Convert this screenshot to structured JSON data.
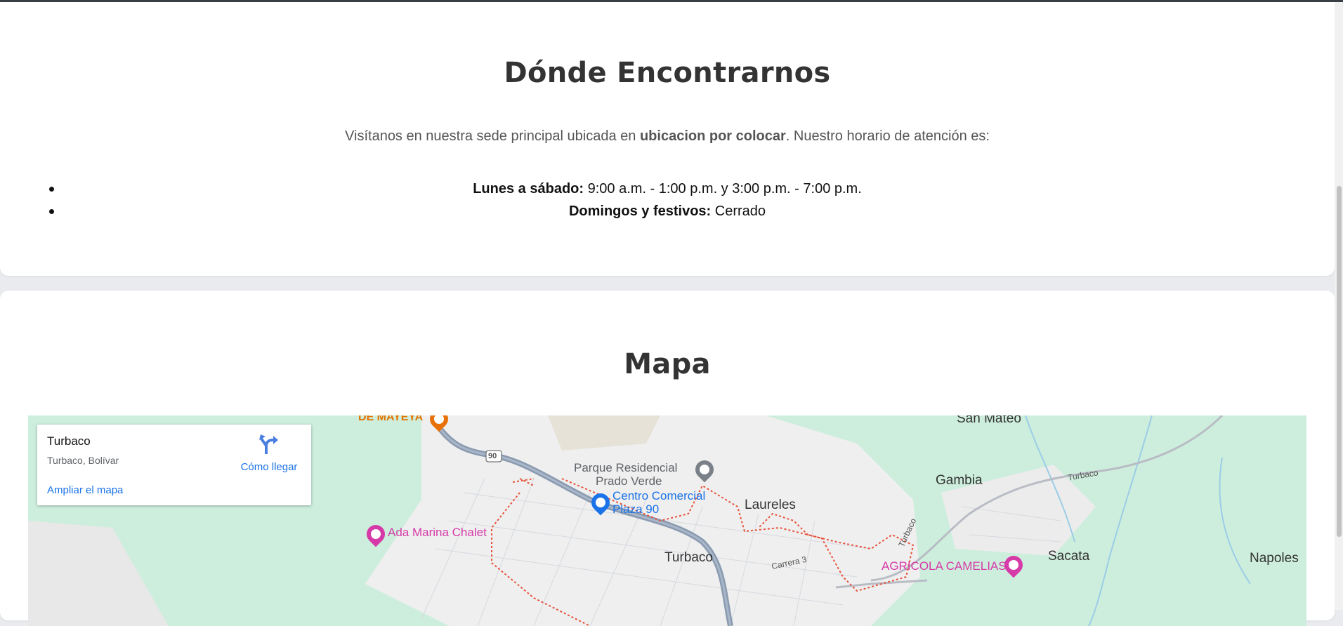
{
  "contact": {
    "title": "Dónde Encontrarnos",
    "intro_before": "Visítanos en nuestra sede principal ubicada en ",
    "intro_location": "ubicacion por colocar",
    "intro_after": ". Nuestro horario de atención es:",
    "hours": [
      {
        "label": "Lunes a sábado:",
        "value": " 9:00 a.m. - 1:00 p.m. y 3:00 p.m. - 7:00 p.m."
      },
      {
        "label": "Domingos y festivos:",
        "value": " Cerrado"
      }
    ]
  },
  "map_section": {
    "title": "Mapa",
    "info_card": {
      "place": "Turbaco",
      "region": "Turbaco, Bolívar",
      "directions_label": "Cómo llegar",
      "enlarge_label": "Ampliar el mapa",
      "directions_icon": "directions-icon"
    },
    "labels": {
      "mayeya": "DE MAYEYA",
      "san_mateo": "San Mateo",
      "parque_1": "Parque Residencial",
      "parque_2": "Prado Verde",
      "gambia": "Gambia",
      "turbaco_road": "Turbaco",
      "cc_1": "Centro Comercial",
      "cc_2": "Plaza 90",
      "laureles": "Laureles",
      "ada": "Ada Marina Chalet",
      "turbaco_road2": "Turbaco",
      "turbaco_town": "Turbaco",
      "carrera": "Carrera 3",
      "agricola": "AGRICOLA CAMELIAS",
      "sacata": "Sacata",
      "napoles": "Napoles",
      "route_90": "90"
    }
  },
  "colors": {
    "title": "#333333",
    "link": "#1a73e8",
    "poi_pink": "#d63aa8",
    "map_green": "#cdeedd",
    "highway": "#8a9ab0"
  }
}
